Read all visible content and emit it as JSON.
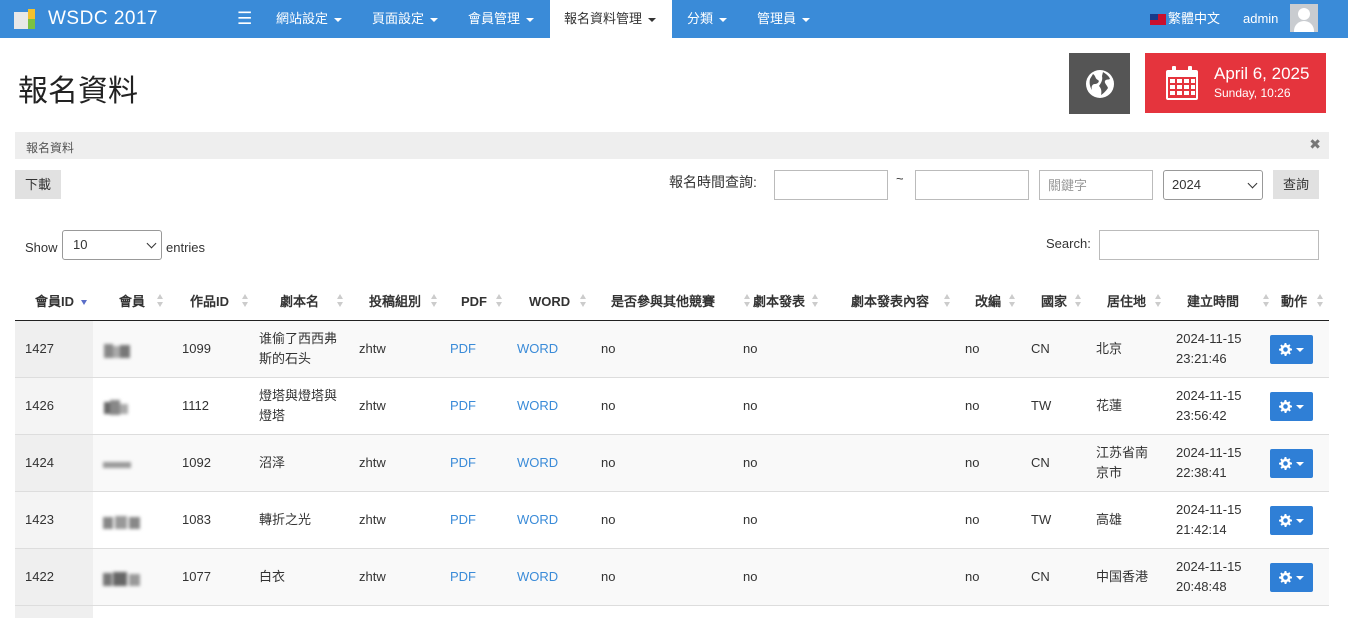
{
  "navbar": {
    "brand": "WSDC 2017",
    "menu": [
      {
        "label": "網站設定"
      },
      {
        "label": "頁面設定"
      },
      {
        "label": "會員管理"
      },
      {
        "label": "報名資料管理"
      },
      {
        "label": "分類"
      },
      {
        "label": "管理員"
      }
    ],
    "active_menu": "報名資料管理",
    "language": "繁體中文",
    "user": "admin"
  },
  "page": {
    "title": "報名資料",
    "breadcrumb": "報名資料",
    "date_main": "April 6, 2025",
    "date_sub": "Sunday, 10:26"
  },
  "toolbar": {
    "download_label": "下載",
    "time_query_label": "報名時間查詢:",
    "date_from_value": "",
    "date_to_value": "",
    "range_separator": "~",
    "keyword_placeholder": "關鍵字",
    "year_selected": "2024",
    "query_label": "查詢"
  },
  "datatable": {
    "show_label": "Show",
    "entries_value": "10",
    "entries_label": "entries",
    "search_label": "Search:",
    "search_value": "",
    "columns": [
      "會員ID",
      "會員",
      "作品ID",
      "劇本名",
      "投稿組別",
      "PDF",
      "WORD",
      "是否參與其他競賽",
      "劇本發表",
      "劇本發表內容",
      "改編",
      "國家",
      "居住地",
      "建立時間",
      "動作"
    ],
    "rows": [
      {
        "member_id": "1427",
        "work_id": "1099",
        "title_line1": "谁偷了西西弗",
        "title_line2": "斯的石头",
        "group": "zhtw",
        "pdf": "PDF",
        "word": "WORD",
        "other_competition": "no",
        "published": "no",
        "published_content": "",
        "adapted": "no",
        "country": "CN",
        "residence_line1": "北京",
        "residence_line2": "",
        "created_date": "2024-11-15",
        "created_time": "23:21:46"
      },
      {
        "member_id": "1426",
        "work_id": "1112",
        "title_line1": "燈塔與燈塔與",
        "title_line2": "燈塔",
        "group": "zhtw",
        "pdf": "PDF",
        "word": "WORD",
        "other_competition": "no",
        "published": "no",
        "published_content": "",
        "adapted": "no",
        "country": "TW",
        "residence_line1": "花蓮",
        "residence_line2": "",
        "created_date": "2024-11-15",
        "created_time": "23:56:42"
      },
      {
        "member_id": "1424",
        "work_id": "1092",
        "title_line1": "沼泽",
        "title_line2": "",
        "group": "zhtw",
        "pdf": "PDF",
        "word": "WORD",
        "other_competition": "no",
        "published": "no",
        "published_content": "",
        "adapted": "no",
        "country": "CN",
        "residence_line1": "江苏省南",
        "residence_line2": "京市",
        "created_date": "2024-11-15",
        "created_time": "22:38:41"
      },
      {
        "member_id": "1423",
        "work_id": "1083",
        "title_line1": "轉折之光",
        "title_line2": "",
        "group": "zhtw",
        "pdf": "PDF",
        "word": "WORD",
        "other_competition": "no",
        "published": "no",
        "published_content": "",
        "adapted": "no",
        "country": "TW",
        "residence_line1": "高雄",
        "residence_line2": "",
        "created_date": "2024-11-15",
        "created_time": "21:42:14"
      },
      {
        "member_id": "1422",
        "work_id": "1077",
        "title_line1": "白衣",
        "title_line2": "",
        "group": "zhtw",
        "pdf": "PDF",
        "word": "WORD",
        "other_competition": "no",
        "published": "no",
        "published_content": "",
        "adapted": "no",
        "country": "CN",
        "residence_line1": "中国香港",
        "residence_line2": "",
        "created_date": "2024-11-15",
        "created_time": "20:48:48"
      }
    ]
  },
  "colors": {
    "navbar": "#3a8bd8",
    "date_box": "#e5343d",
    "globe_box": "#555555",
    "action_button": "#2f7fd6",
    "link": "#3a8bd8"
  },
  "icons": [
    "menu-icon",
    "caret-down-icon",
    "taiwan-flag-icon",
    "user-avatar-icon",
    "globe-icon",
    "calendar-icon",
    "close-icon",
    "sort-icon",
    "gear-icon"
  ]
}
